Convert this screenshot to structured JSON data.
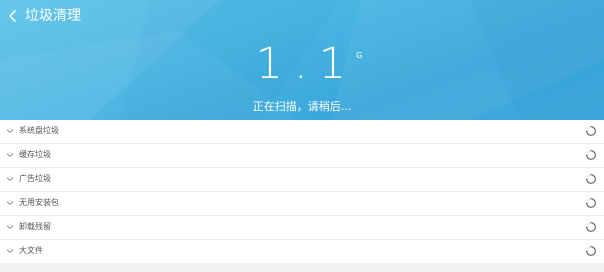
{
  "header": {
    "title": "垃圾清理",
    "size_value": "1.1",
    "size_unit": "G",
    "status": "正在扫描，请稍后..."
  },
  "colors": {
    "header_bg": "#49b6e2",
    "text_light": "#ffffff",
    "item_text": "#555555"
  },
  "icons": {
    "back": "chevron-left-icon",
    "expand": "chevron-down-icon",
    "loading": "loading-spinner-icon"
  },
  "categories": [
    {
      "label": "系统盘垃圾"
    },
    {
      "label": "缓存垃圾"
    },
    {
      "label": "广告垃圾"
    },
    {
      "label": "无用安装包"
    },
    {
      "label": "卸载残留"
    },
    {
      "label": "大文件"
    }
  ]
}
